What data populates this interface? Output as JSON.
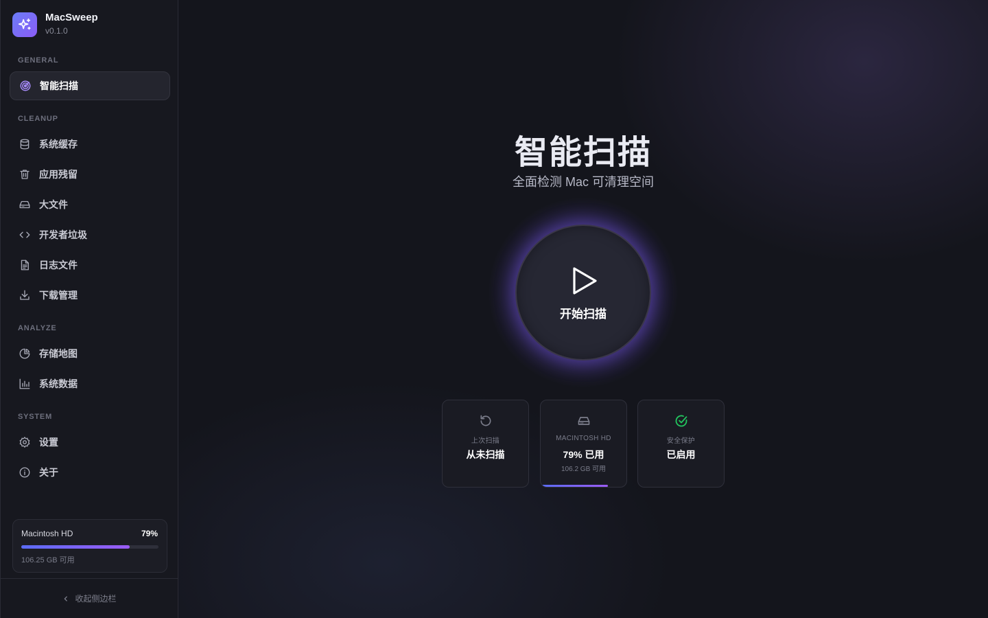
{
  "app": {
    "name": "MacSweep",
    "version": "v0.1.0"
  },
  "sidebar": {
    "sections": {
      "general": "GENERAL",
      "cleanup": "CLEANUP",
      "analyze": "ANALYZE",
      "system": "SYSTEM"
    },
    "items": [
      {
        "label": "智能扫描",
        "icon": "radar-icon",
        "active": true
      },
      {
        "label": "系统缓存",
        "icon": "database-icon"
      },
      {
        "label": "应用残留",
        "icon": "trash-icon"
      },
      {
        "label": "大文件",
        "icon": "hard-drive-icon"
      },
      {
        "label": "开发者垃圾",
        "icon": "code-icon"
      },
      {
        "label": "日志文件",
        "icon": "file-text-icon"
      },
      {
        "label": "下载管理",
        "icon": "download-icon"
      },
      {
        "label": "存储地图",
        "icon": "pie-chart-icon"
      },
      {
        "label": "系统数据",
        "icon": "bar-chart-icon"
      },
      {
        "label": "设置",
        "icon": "gear-icon"
      },
      {
        "label": "关于",
        "icon": "info-icon"
      }
    ],
    "disk": {
      "name": "Macintosh HD",
      "percent_label": "79%",
      "used_fraction": 0.79,
      "free": "106.25 GB 可用"
    },
    "collapse_label": "收起侧边栏"
  },
  "main": {
    "title": "智能扫描",
    "subtitle": "全面检测 Mac 可清理空间",
    "scan_button_label": "开始扫描",
    "stats": [
      {
        "icon": "history-icon",
        "label": "上次扫描",
        "value": "从未扫描"
      },
      {
        "icon": "hard-drive-icon",
        "label": "MACINTOSH HD",
        "value": "79% 已用",
        "sub": "106.2 GB 可用",
        "used_fraction": 0.79
      },
      {
        "icon": "check-circle-icon",
        "label": "安全保护",
        "value": "已启用"
      }
    ]
  },
  "colors": {
    "accent": "#8b5cf6",
    "accent_blue": "#5b6cf5",
    "success": "#22c55e"
  }
}
